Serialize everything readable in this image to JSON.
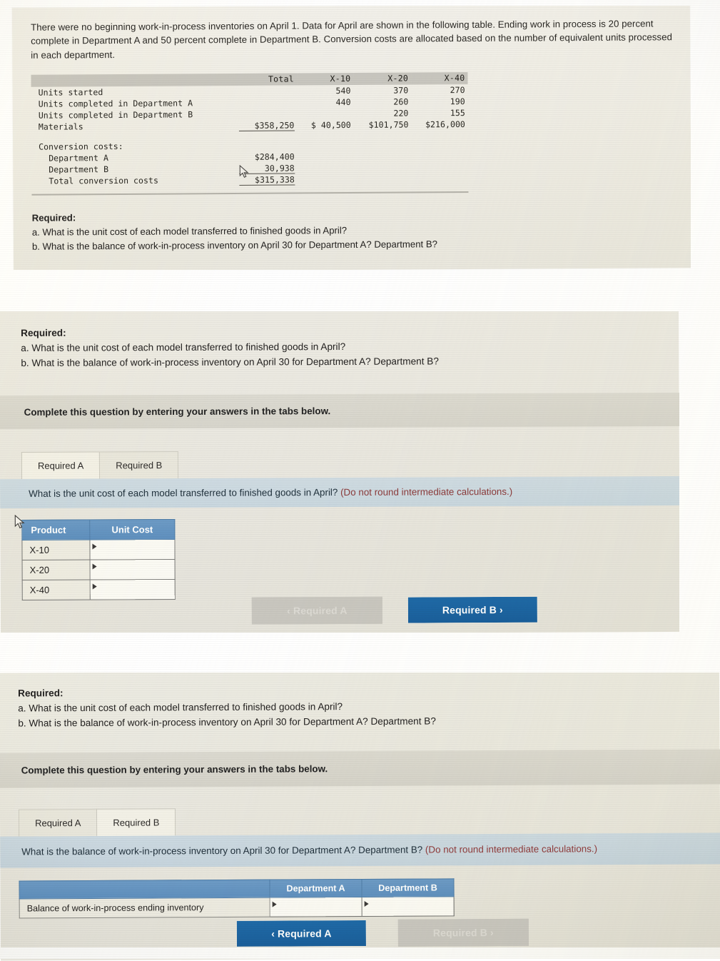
{
  "problem": {
    "intro": "There were no beginning work-in-process inventories on April 1. Data for April are shown in the following table. Ending work in process is 20 percent complete in Department A and 50 percent complete in Department B. Conversion costs are allocated based on the number of equivalent units processed in each department.",
    "table": {
      "columns": [
        "",
        "Total",
        "X-10",
        "X-20",
        "X-40"
      ],
      "rows": [
        {
          "label": "Units started",
          "total": "",
          "x10": "540",
          "x20": "370",
          "x40": "270"
        },
        {
          "label": "Units completed in Department A",
          "total": "",
          "x10": "440",
          "x20": "260",
          "x40": "190"
        },
        {
          "label": "Units completed in Department B",
          "total": "",
          "x10": "",
          "x20": "220",
          "x40": "155"
        },
        {
          "label": "Materials",
          "total": "$358,250",
          "x10": "$ 40,500",
          "x20": "$101,750",
          "x40": "$216,000"
        }
      ],
      "conversion_header": "Conversion costs:",
      "conversion_rows": [
        {
          "label": "Department A",
          "total": "$284,400"
        },
        {
          "label": "Department B",
          "total": "30,938"
        },
        {
          "label": "Total conversion costs",
          "total": "$315,338"
        }
      ]
    },
    "required_title": "Required:",
    "required_a": "a. What is the unit cost of each model transferred to finished goods in April?",
    "required_b": "b. What is the balance of work-in-process inventory on April 30 for Department A? Department B?"
  },
  "panel_a": {
    "required_title": "Required:",
    "required_a": "a. What is the unit cost of each model transferred to finished goods in April?",
    "required_b": "b. What is the balance of work-in-process inventory on April 30 for Department A? Department B?",
    "complete_banner": "Complete this question by entering your answers in the tabs below.",
    "tabs": [
      {
        "label": "Required A",
        "active": true
      },
      {
        "label": "Required B",
        "active": false
      }
    ],
    "question": "What is the unit cost of each model transferred to finished goods in April? ",
    "question_note": "(Do not round intermediate calculations.)",
    "answer_table": {
      "headers": [
        "Product",
        "Unit Cost"
      ],
      "rows": [
        {
          "product": "X-10",
          "unit_cost": ""
        },
        {
          "product": "X-20",
          "unit_cost": ""
        },
        {
          "product": "X-40",
          "unit_cost": ""
        }
      ]
    },
    "nav": {
      "prev_label": "Required A",
      "prev_chevron": "‹",
      "next_label": "Required B",
      "next_chevron": "›"
    }
  },
  "panel_b": {
    "required_title": "Required:",
    "required_a": "a. What is the unit cost of each model transferred to finished goods in April?",
    "required_b": "b. What is the balance of work-in-process inventory on April 30 for Department A? Department B?",
    "complete_banner": "Complete this question by entering your answers in the tabs below.",
    "tabs": [
      {
        "label": "Required A",
        "active": false
      },
      {
        "label": "Required B",
        "active": true
      }
    ],
    "question": "What is the balance of work-in-process inventory on April 30 for Department A? Department B? ",
    "question_note": "(Do not round intermediate calculations.)",
    "answer_table": {
      "headers": [
        "",
        "Department A",
        "Department B"
      ],
      "rows": [
        {
          "label": "Balance of work-in-process ending inventory",
          "dept_a": "",
          "dept_b": ""
        }
      ]
    },
    "nav": {
      "prev_label": "Required A",
      "prev_chevron": "‹",
      "next_label": "Required B",
      "next_chevron": "›"
    }
  },
  "colors": {
    "accent_blue": "#1f6aa8",
    "table_header_blue": "#5f90bf",
    "note_red": "#8b3a3a",
    "question_band": "#c9d7df"
  }
}
